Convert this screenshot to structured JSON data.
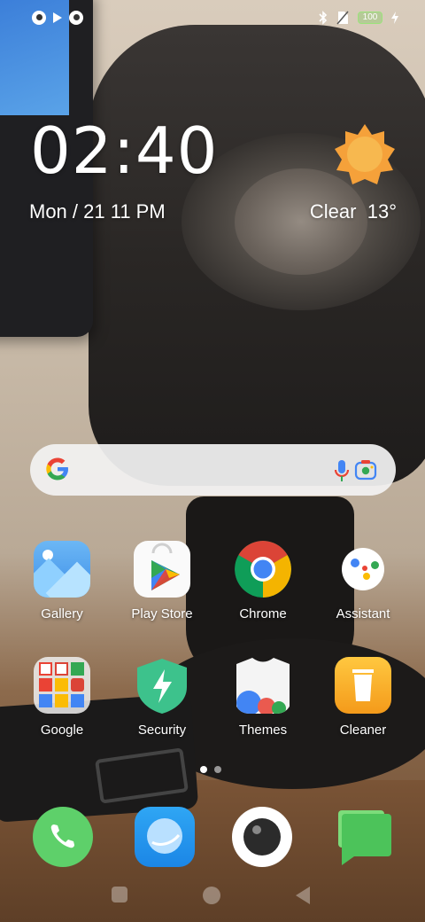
{
  "status_bar": {
    "battery": "100"
  },
  "clock_widget": {
    "time": "02:40",
    "date": "Mon / 21  11 PM"
  },
  "weather_widget": {
    "condition": "Clear",
    "temperature": "13°",
    "icon": "sun-icon"
  },
  "search_bar": {
    "icons": [
      "google-logo-icon",
      "mic-icon",
      "lens-icon"
    ]
  },
  "apps": [
    {
      "label": "Gallery"
    },
    {
      "label": "Play Store"
    },
    {
      "label": "Chrome"
    },
    {
      "label": "Assistant"
    },
    {
      "label": "Google"
    },
    {
      "label": "Security"
    },
    {
      "label": "Themes"
    },
    {
      "label": "Cleaner"
    }
  ],
  "dock": [
    "phone-icon",
    "messages-bubble-icon",
    "camera-icon",
    "chat-icon"
  ],
  "page_indicator": {
    "pages": 2,
    "active": 1
  },
  "colors": {
    "accent_orange": "#f5a13a",
    "chrome_red": "#db4437",
    "chrome_green": "#0f9d58",
    "chrome_yellow": "#f4b400",
    "chrome_blue": "#4285f4"
  }
}
